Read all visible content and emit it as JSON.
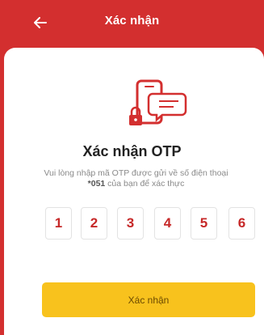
{
  "header": {
    "title": "Xác nhận",
    "back_icon": "arrow-left-icon"
  },
  "main": {
    "illustration_icon": "phone-chat-lock-icon",
    "title": "Xác nhận OTP",
    "description_line1": "Vui lòng nhập mã OTP được gửi về số điện thoại",
    "phone_suffix": "*051",
    "description_line2_rest": " của bạn để xác thực",
    "otp_digits": [
      "1",
      "2",
      "3",
      "4",
      "5",
      "6"
    ],
    "confirm_label": "Xác nhận"
  },
  "colors": {
    "brand_red": "#d32f2f",
    "otp_digit": "#c62828",
    "button_yellow": "#f8c21d"
  }
}
